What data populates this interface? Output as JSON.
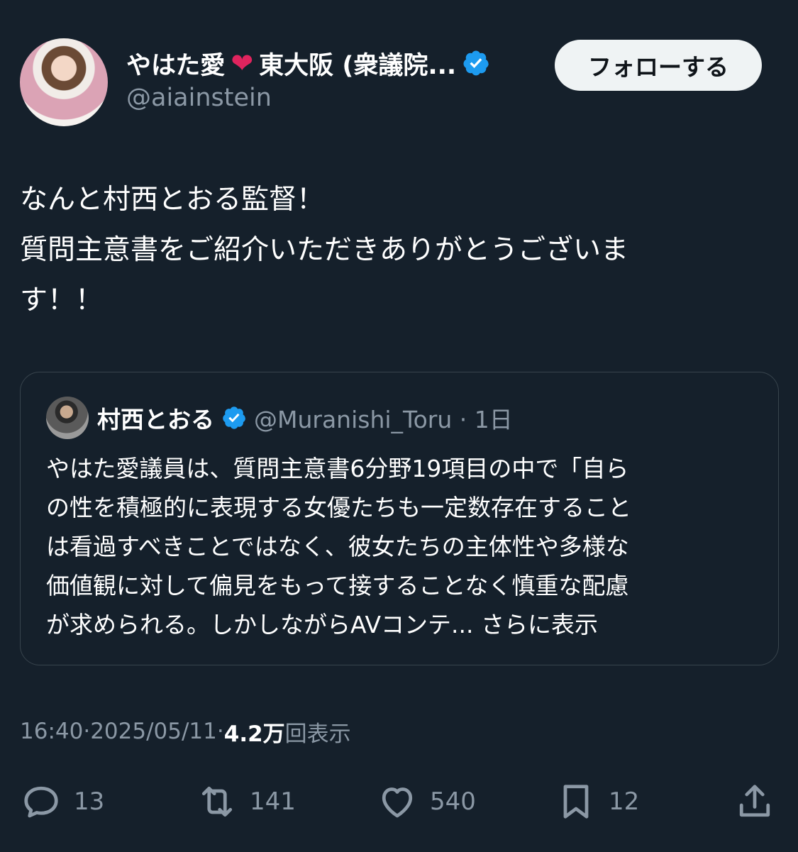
{
  "author": {
    "name": "やはた愛",
    "name_suffix": "東大阪 (衆議院...",
    "handle": "@aiainstein"
  },
  "follow_label": "フォローする",
  "tweet": {
    "lines": [
      "なんと村西とおる監督！",
      "質問主意書をご紹介いただきありがとうございま",
      "す！！"
    ]
  },
  "quote": {
    "name": "村西とおる",
    "handle": "@Muranishi_Toru · 1日",
    "lines": [
      "やはた愛議員は、質問主意書6分野19項目の中で「自ら",
      "の性を積極的に表現する女優たちも一定数存在すること",
      "は看過すべきことではなく、彼女たちの主体性や多様な",
      "価値観に対して偏見をもって接することなく慎重な配慮",
      "が求められる。しかしながらAVコンテ..."
    ],
    "show_more": "さらに表示"
  },
  "meta": {
    "time": "16:40",
    "separator": " · ",
    "date": "2025/05/11",
    "views": "4.2万",
    "views_label": "回表示"
  },
  "actions": {
    "replies": "13",
    "retweets": "141",
    "likes": "540",
    "bookmarks": "12"
  },
  "colors": {
    "background": "#15202b",
    "secondary_text": "#8b98a5",
    "verified": "#1d9bf0",
    "heart": "#e0245e",
    "border": "#38444d"
  }
}
